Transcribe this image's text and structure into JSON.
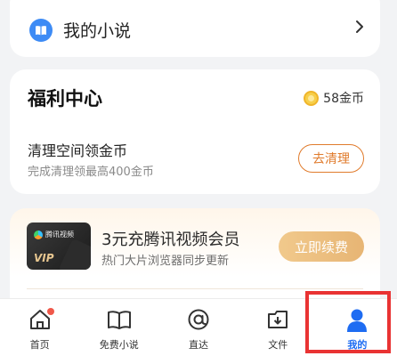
{
  "my_novels": {
    "label": "我的小说",
    "icon": "book-icon"
  },
  "welfare": {
    "title": "福利中心",
    "coins": "58金币",
    "task": {
      "title": "清理空间领金币",
      "subtitle": "完成清理领最高400金币",
      "button": "去清理"
    }
  },
  "vip_promo": {
    "banner_logo_text": "腾讯视频",
    "banner_badge": "VIP",
    "title": "3元充腾讯视频会员",
    "subtitle": "热门大片浏览器同步更新",
    "button": "立即续费"
  },
  "bottom_nav": {
    "items": [
      {
        "label": "首页",
        "icon": "home-icon",
        "has_badge": true
      },
      {
        "label": "免费小说",
        "icon": "open-book-icon"
      },
      {
        "label": "直达",
        "icon": "at-sign-icon"
      },
      {
        "label": "文件",
        "icon": "file-download-icon"
      },
      {
        "label": "我的",
        "icon": "user-profile-icon",
        "active": true
      }
    ]
  },
  "colors": {
    "accent_blue": "#1e6cf2",
    "accent_orange": "#e07b2c",
    "vip_gold": "#e7b574",
    "highlight_red": "#e93333"
  }
}
